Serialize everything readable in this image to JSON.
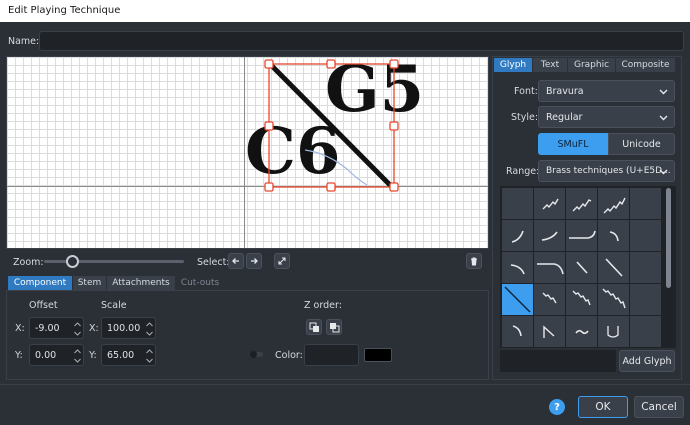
{
  "window": {
    "title": "Edit Playing Technique"
  },
  "name_field": {
    "label": "Name:",
    "value": ""
  },
  "canvas": {
    "glyph_left": "C6",
    "glyph_right": "G5"
  },
  "toolbar": {
    "zoom_label": "Zoom:",
    "zoom_level": 0.2,
    "select_label": "Select:"
  },
  "bottom_tabs": [
    "Component",
    "Stem",
    "Attachments",
    "Cut-outs"
  ],
  "offset": {
    "heading": "Offset",
    "x_label": "X:",
    "x_value": "-9.00",
    "y_label": "Y:",
    "y_value": "0.00"
  },
  "scale": {
    "heading": "Scale",
    "x_label": "X:",
    "x_value": "100.00",
    "y_label": "Y:",
    "y_value": "65.00"
  },
  "z_order": {
    "label": "Z order:"
  },
  "color": {
    "label": "Color:",
    "swatch": "#000000"
  },
  "right_tabs": [
    "Glyph",
    "Text",
    "Graphic",
    "Composite"
  ],
  "glyph_panel": {
    "font_label": "Font:",
    "font_value": "Bravura",
    "style_label": "Style:",
    "style_value": "Regular",
    "mode_smufl": "SMuFL",
    "mode_unicode": "Unicode",
    "range_label": "Range:",
    "range_value": "Brass techniques (U+E5D...",
    "add_glyph": "Add Glyph"
  },
  "footer": {
    "help": "?",
    "ok": "OK",
    "cancel": "Cancel"
  },
  "colors": {
    "accent": "#3d9ef0",
    "handle": "#e8472d",
    "tab_active": "#2f7ac0"
  }
}
